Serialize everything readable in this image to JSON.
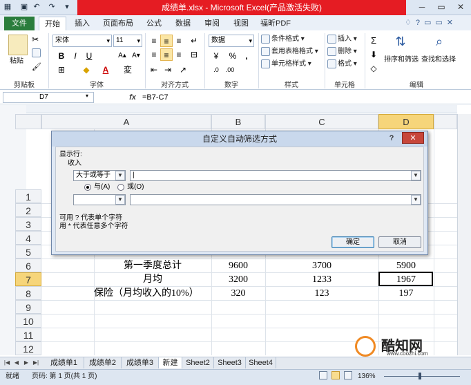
{
  "window": {
    "title": "成绩单.xlsx - Microsoft Excel(产品激活失败)",
    "help": "?",
    "minimize": "─",
    "restore": "▭",
    "close": "✕"
  },
  "ribbon_tabs": [
    "文件",
    "开始",
    "插入",
    "页面布局",
    "公式",
    "数据",
    "审阅",
    "视图",
    "福昕PDF"
  ],
  "ribbon": {
    "paste": "粘贴",
    "font_name": "宋体",
    "font_size": "11",
    "number_format": "数据",
    "bold": "B",
    "italic": "I",
    "underline": "U",
    "percent": "%",
    "comma": ",",
    "conditional_format": "条件格式",
    "table_format": "套用表格格式",
    "cell_style": "单元格样式",
    "insert": "插入",
    "delete": "删除",
    "format": "格式",
    "sort_filter": "排序和筛选",
    "find_select": "查找和选择",
    "groups": [
      "剪贴板",
      "字体",
      "对齐方式",
      "数字",
      "样式",
      "单元格",
      "编辑"
    ]
  },
  "formula_bar": {
    "name_box": "D7",
    "fx": "fx",
    "formula": "=B7-C7"
  },
  "columns": [
    "A",
    "B",
    "C",
    "D"
  ],
  "rows": [
    "1",
    "2",
    "3",
    "4",
    "5",
    "6",
    "7",
    "8",
    "9",
    "10",
    "11",
    "12"
  ],
  "cells": [
    {
      "row": "6",
      "a": "第一季度总计",
      "b": "9600",
      "c": "3700",
      "d": "5900"
    },
    {
      "row": "7",
      "a": "月均",
      "b": "3200",
      "c": "1233",
      "d": "1967"
    },
    {
      "row": "8",
      "a": "保险（月均收入的10%）",
      "b": "320",
      "c": "123",
      "d": "197"
    }
  ],
  "dialog": {
    "title": "自定义自动筛选方式",
    "help": "?",
    "close": "✕",
    "show_rows": "显示行:",
    "field": "收入",
    "operator1": "大于或等于",
    "value1": "|",
    "and_label": "与(A)",
    "or_label": "或(O)",
    "operator2": "",
    "value2": "",
    "hint1": "可用 ? 代表单个字符",
    "hint2": "用 * 代表任意多个字符",
    "ok": "确定",
    "cancel": "取消"
  },
  "sheet_tabs": [
    "成绩单1",
    "成绩单2",
    "成绩单3",
    "新建",
    "Sheet2",
    "Sheet3",
    "Sheet4"
  ],
  "status": {
    "mode": "就绪",
    "page": "页码: 第 1 页(共 1 页)",
    "zoom": "136%"
  },
  "watermark": {
    "brand": "酷知网",
    "url": "www.coozhi.com"
  }
}
